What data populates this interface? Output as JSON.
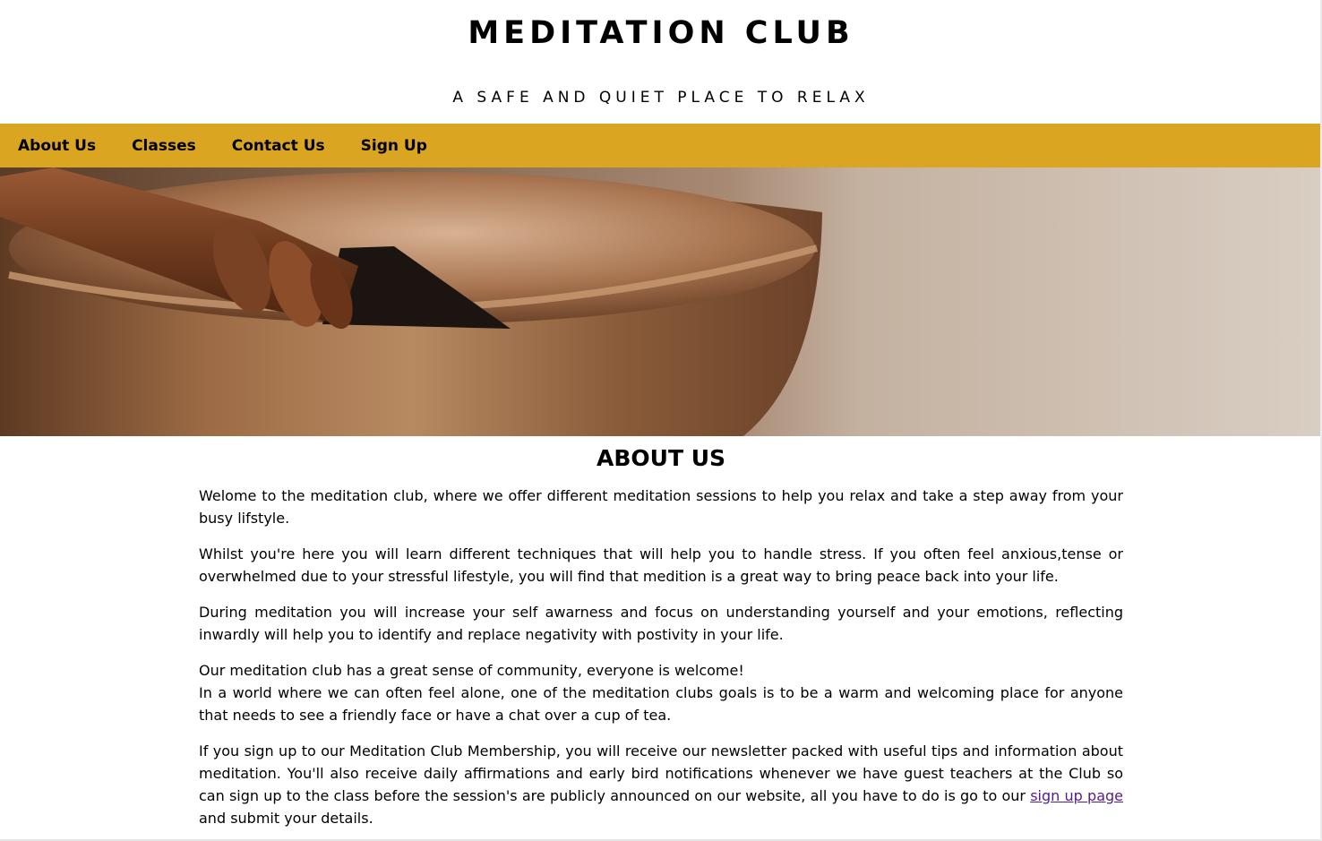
{
  "header": {
    "title": "MEDITATION CLUB",
    "tagline": "A SAFE AND QUIET PLACE TO RELAX"
  },
  "nav": {
    "items": [
      {
        "label": "About Us"
      },
      {
        "label": "Classes"
      },
      {
        "label": "Contact Us"
      },
      {
        "label": "Sign Up"
      }
    ]
  },
  "about": {
    "heading": "ABOUT US",
    "p1": "Welome to the meditation club, where we offer different meditation sessions to help you relax and take a step away from your busy lifstyle.",
    "p2": "Whilst you're here you will learn different techniques that will help you to handle stress. If you often feel anxious,tense or overwhelmed due to your stressful lifestyle, you will find that medition is a great way to bring peace back into your life.",
    "p3": "During meditation you will increase your self awarness and focus on understanding yourself and your emotions, reflecting inwardly will help you to identify and replace negativity with postivity in your life.",
    "p4_line1": "Our meditation club has a great sense of community, everyone is welcome!",
    "p4_line2": "In a world where we can often feel alone, one of the meditation clubs goals is to be a warm and welcoming place for anyone that needs to see a friendly face or have a chat over a cup of tea.",
    "p5_before": "If you sign up to our Meditation Club Membership, you will receive our newsletter packed with useful tips and information about meditation. You'll also receive daily affirmations and early bird notifications whenever we have guest teachers at the Club so can sign up to the class before the session's are publicly announced on our website, all you have to do is go to our ",
    "p5_link": "sign up page",
    "p5_after": " and submit your details."
  },
  "colors": {
    "nav_background": "#daa520",
    "link": "#551a8b"
  }
}
